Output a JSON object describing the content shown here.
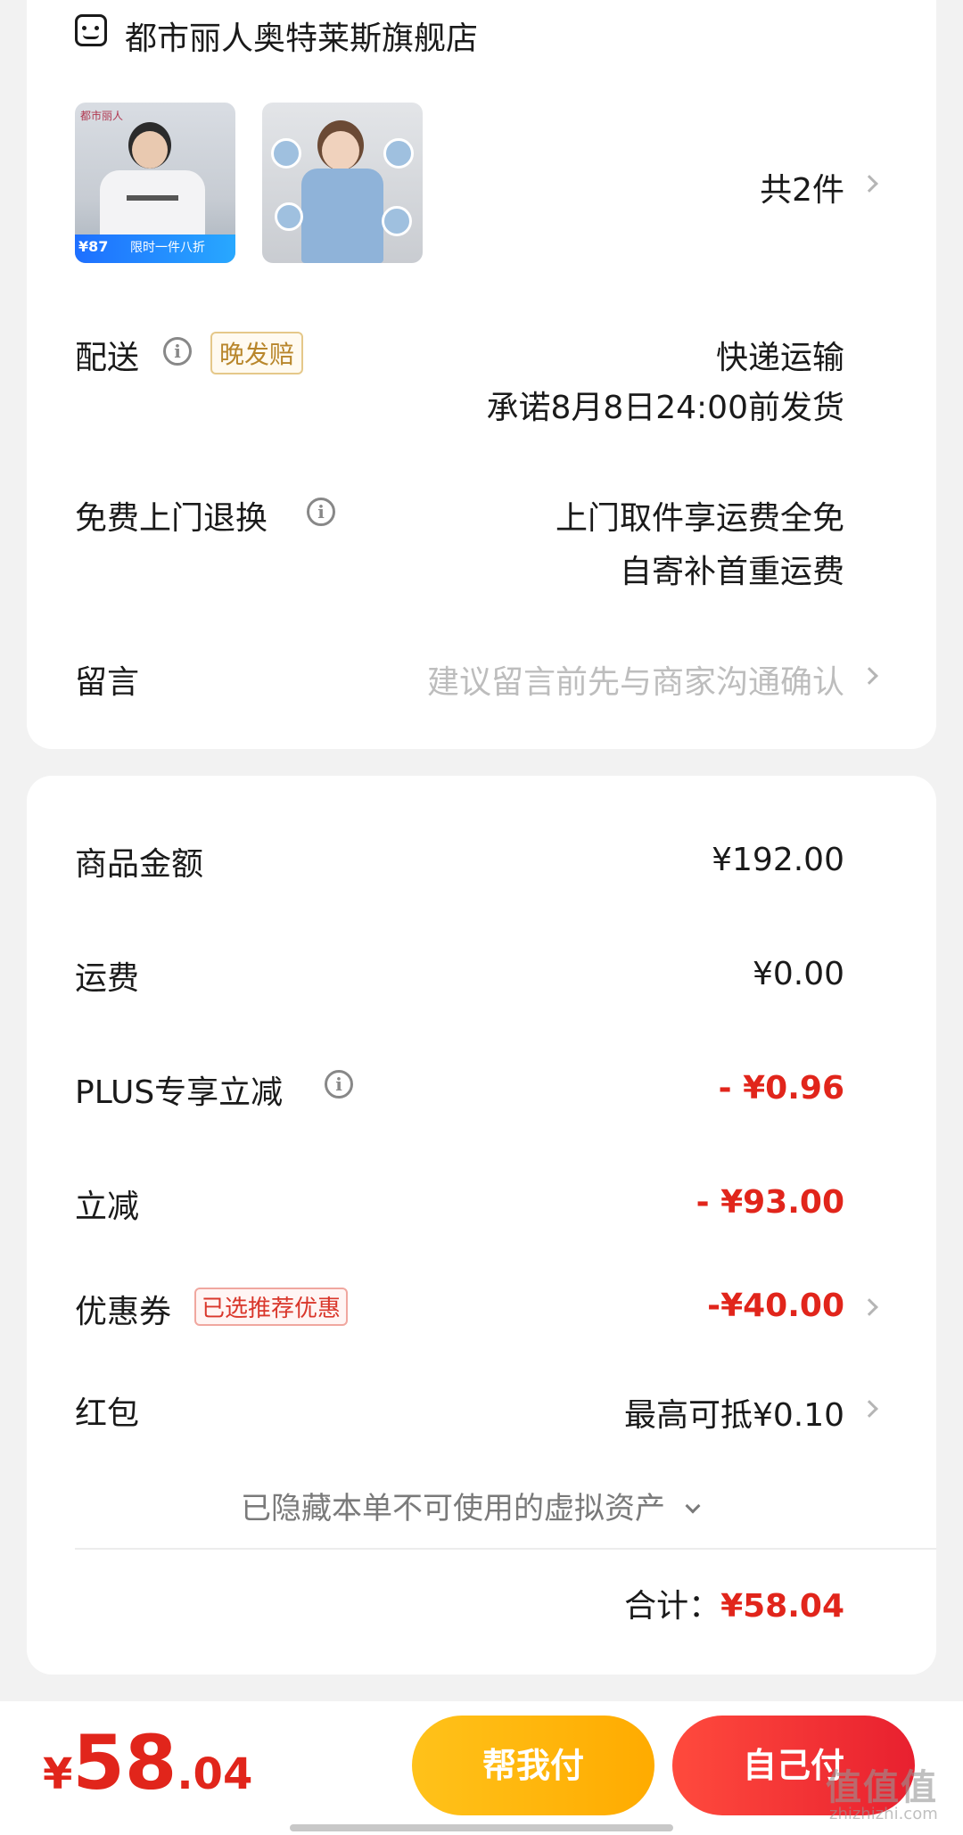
{
  "store": {
    "icon": "store-icon",
    "name": "都市丽人奥特莱斯旗舰店"
  },
  "products": {
    "thumb1": {
      "brand_text": "都市丽人",
      "price_badge": "¥87",
      "promo_text": "限时一件八折"
    },
    "count_label": "共2件"
  },
  "shipping": {
    "label": "配送",
    "tag": "晚发赔",
    "method": "快递运输",
    "promise": "承诺8月8日24:00前发货"
  },
  "returns": {
    "label": "免费上门退换",
    "line1": "上门取件享运费全免",
    "line2": "自寄补首重运费"
  },
  "message": {
    "label": "留言",
    "placeholder": "建议留言前先与商家沟通确认"
  },
  "summary": {
    "goods_label": "商品金额",
    "goods_value": "¥192.00",
    "freight_label": "运费",
    "freight_value": "¥0.00",
    "plus_label": "PLUS专享立减",
    "plus_value": "- ¥0.96",
    "discount_label": "立减",
    "discount_value": "- ¥93.00",
    "coupon_label": "优惠券",
    "coupon_tag": "已选推荐优惠",
    "coupon_value": "-¥40.00",
    "redpacket_label": "红包",
    "redpacket_value": "最高可抵¥0.10",
    "hidden_assets": "已隐藏本单不可使用的虚拟资产",
    "total_label": "合计：",
    "total_value": "¥58.04"
  },
  "bottom": {
    "currency": "¥",
    "price_int": "58",
    "price_dec": ".04",
    "help_pay": "帮我付",
    "self_pay": "自己付",
    "watermark": "值值值",
    "watermark_url": "zhizhizhi.com"
  },
  "colors": {
    "accent_red": "#e1251b",
    "help_btn": "#ffb300",
    "self_btn": "#f02c31"
  }
}
